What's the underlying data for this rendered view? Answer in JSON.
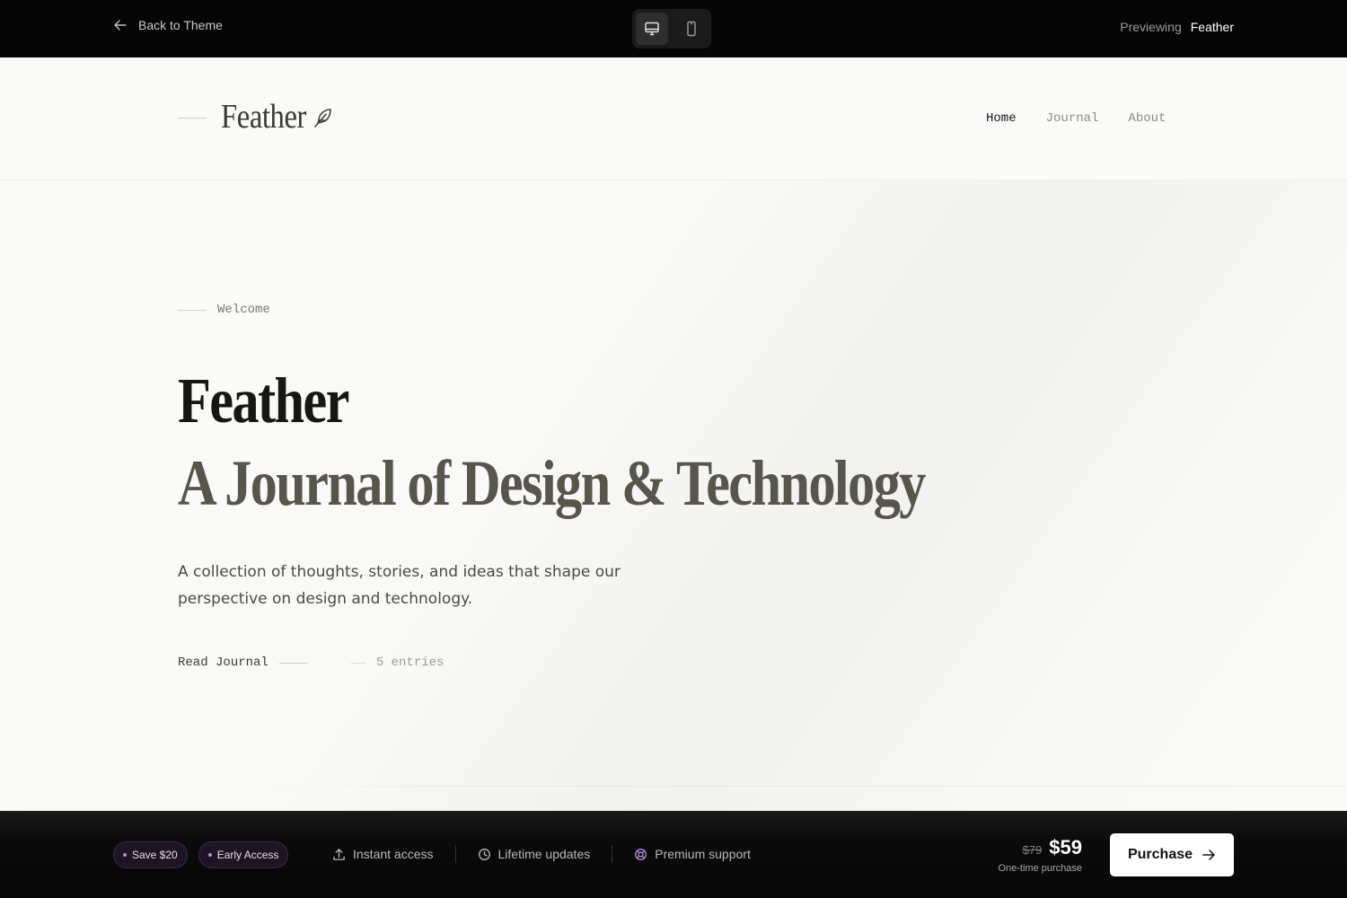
{
  "preview_bar": {
    "back_label": "Back to Theme",
    "previewing_label": "Previewing",
    "theme_name": "Feather",
    "devices": [
      "desktop-icon",
      "mobile-icon"
    ]
  },
  "site_header": {
    "logo_text": "Feather",
    "nav": [
      {
        "label": "Home",
        "active": true
      },
      {
        "label": "Journal",
        "active": false
      },
      {
        "label": "About",
        "active": false
      }
    ]
  },
  "hero": {
    "eyebrow": "Welcome",
    "title": "Feather",
    "subtitle": "A Journal of Design & Technology",
    "description": "A collection of thoughts, stories, and ideas that shape our perspective on design and technology.",
    "cta_label": "Read Journal",
    "entries_label": "5 entries"
  },
  "buy_bar": {
    "badges": [
      "Save $20",
      "Early Access"
    ],
    "features": [
      {
        "icon": "upload-icon",
        "label": "Instant access"
      },
      {
        "icon": "clock-icon",
        "label": "Lifetime updates"
      },
      {
        "icon": "lifebuoy-icon",
        "label": "Premium support"
      }
    ],
    "old_price": "$79",
    "new_price": "$59",
    "price_note": "One-time purchase",
    "purchase_label": "Purchase"
  },
  "colors": {
    "top_bar": "#050505",
    "page_bg": "#fafaf8",
    "badge_accent": "#b48ad6",
    "subtitle": "#57554c"
  }
}
